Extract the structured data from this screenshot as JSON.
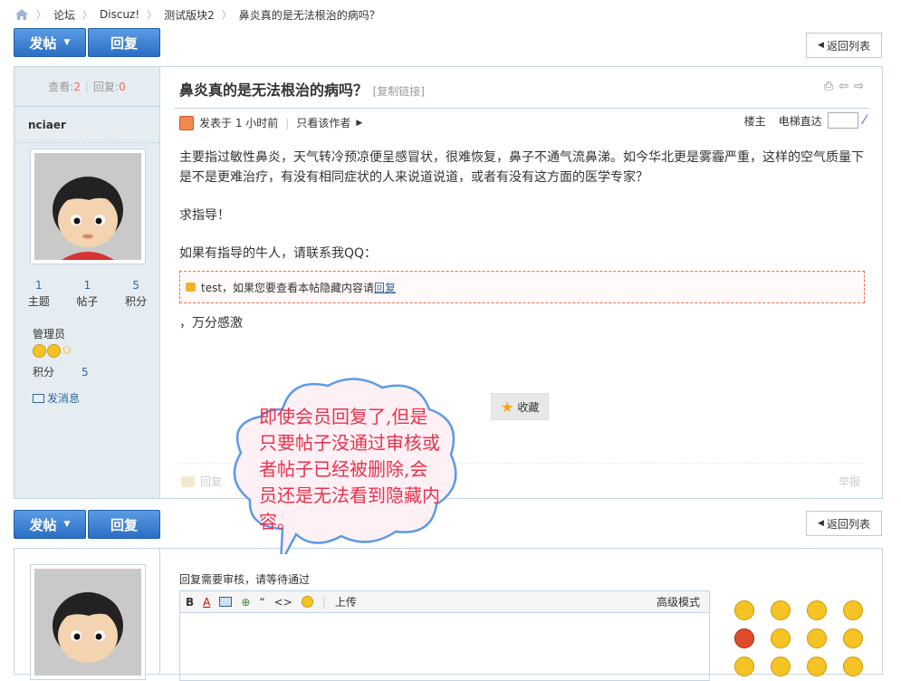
{
  "breadcrumb": {
    "items": [
      "论坛",
      "Discuz!",
      "测试版块2",
      "鼻炎真的是无法根治的病吗？"
    ]
  },
  "toolbar": {
    "post_label": "发帖",
    "reply_label": "回复",
    "back_label": "返回列表"
  },
  "post": {
    "views_label": "查看:",
    "views": "2",
    "replies_label": "回复:",
    "replies": "0",
    "author": "nciaer",
    "threads": "1",
    "threads_label": "主题",
    "posts": "1",
    "posts_label": "帖子",
    "credits": "5",
    "credits_label": "积分",
    "group": "管理员",
    "score_label": "积分",
    "score": "5",
    "pm_label": "发消息",
    "title": "鼻炎真的是无法根治的病吗？",
    "copy_link": "[复制链接]",
    "posted": "发表于 1 小时前",
    "only_author": "只看该作者",
    "floor": "楼主",
    "jump_label": "电梯直达",
    "body": [
      "主要指过敏性鼻炎，天气转冷预凉便呈感冒状，很难恢复，鼻子不通气流鼻涕。如今华北更是雾霾严重，这样的空气质量下是不是更难治疗，有没有相同症状的人来说道说道，或者有没有这方面的医学专家？",
      "求指导！",
      "如果有指导的牛人，请联系我QQ："
    ],
    "hidden_text": "test，如果您要查看本帖隐藏内容请",
    "hidden_link": "回复",
    "after": "，万分感激",
    "favorite": "收藏",
    "reply": "回复",
    "report": "举报"
  },
  "reply_area": {
    "notice": "回复需要审核，请等待通过",
    "upload": "上传",
    "advanced": "高级模式"
  },
  "annotation": {
    "text": "即使会员回复了,但是只要帖子没通过审核或者帖子已经被删除,会员还是无法看到隐藏内容。"
  }
}
